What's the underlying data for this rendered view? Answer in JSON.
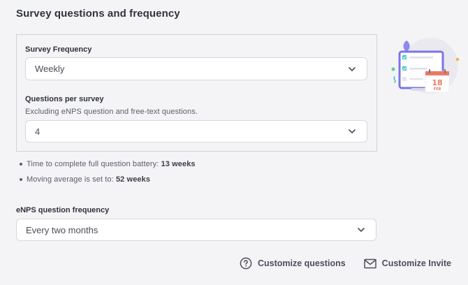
{
  "page_title": "Survey questions and frequency",
  "frequency": {
    "label": "Survey Frequency",
    "value": "Weekly"
  },
  "questions_per_survey": {
    "label": "Questions per survey",
    "help": "Excluding eNPS question and free-text questions.",
    "value": "4"
  },
  "battery": {
    "prefix": "Time to complete full question battery:",
    "value": "13 weeks"
  },
  "moving_average": {
    "prefix": "Moving average is set to:",
    "value": "52 weeks"
  },
  "enps": {
    "label": "eNPS question frequency",
    "value": "Every two months"
  },
  "actions": {
    "customize_questions": "Customize questions",
    "customize_invite": "Customize Invite"
  },
  "illustration": {
    "day": "18",
    "month": "FEB"
  },
  "colors": {
    "background": "#f4f4f6",
    "card_border": "#cfd1d6",
    "accent_teal": "#3cc6c9",
    "accent_purple": "#7b74e8",
    "calendar_red": "#ea7a66"
  },
  "icons": {
    "dropdown": "chevron-down-icon",
    "questions": "question-circle-icon",
    "invite": "envelope-icon"
  }
}
